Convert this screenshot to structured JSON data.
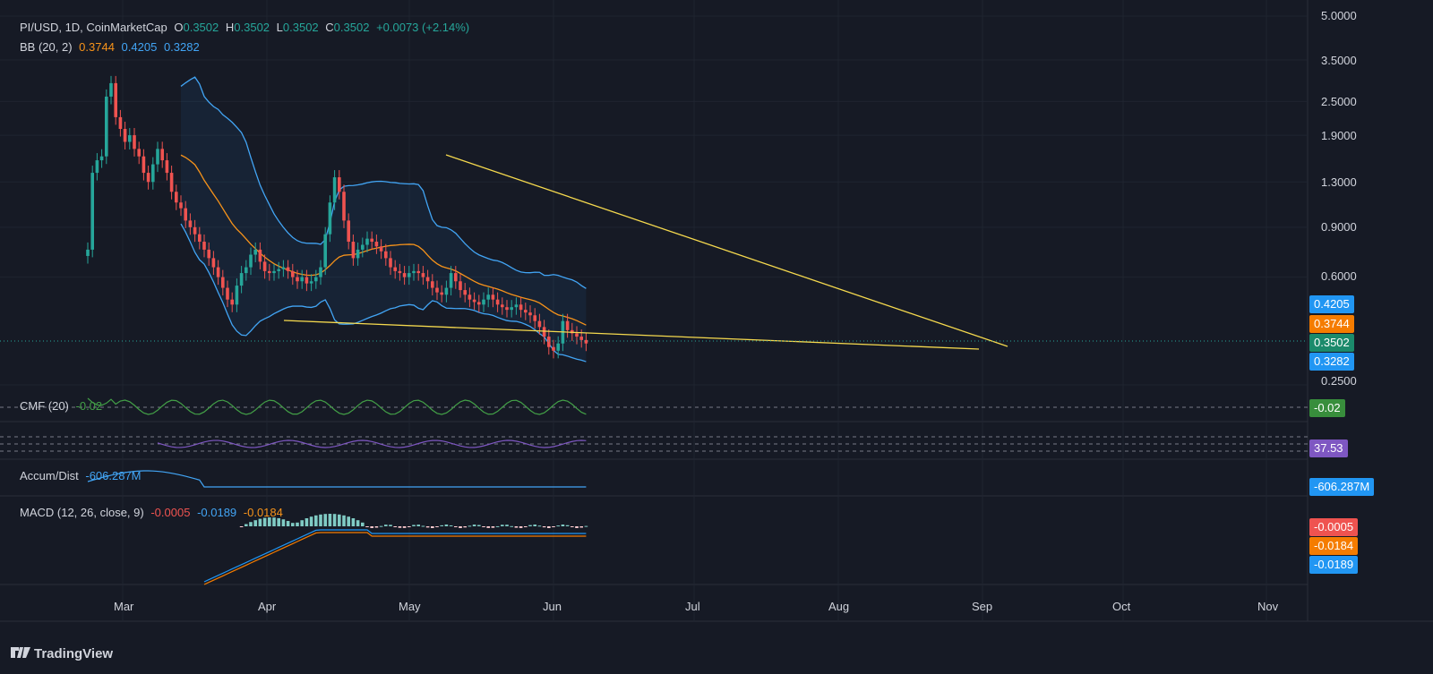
{
  "header": {
    "symbol": "PI/USD, 1D, CoinMarketCap",
    "o_key": "O",
    "o_val": "0.3502",
    "h_key": "H",
    "h_val": "0.3502",
    "l_key": "L",
    "l_val": "0.3502",
    "c_key": "C",
    "c_val": "0.3502",
    "change": "+0.0073 (+2.14%)"
  },
  "bb_legend": {
    "name": "BB (20, 2)",
    "basis": "0.3744",
    "upper": "0.4205",
    "lower": "0.3282"
  },
  "cmf_legend": {
    "name": "CMF (20)",
    "value": "-0.02"
  },
  "ad_legend": {
    "name": "Accum/Dist",
    "value": "-606.287M"
  },
  "macd_legend": {
    "name": "MACD (12, 26, close, 9)",
    "hist": "-0.0005",
    "macd": "-0.0189",
    "signal": "-0.0184"
  },
  "badges": {
    "upper": "0.4205",
    "basis": "0.3744",
    "price": "0.3502",
    "lower": "0.3282",
    "cmf": "-0.02",
    "rsi": "37.53",
    "ad": "-606.287M",
    "macd_hist": "-0.0005",
    "macd_signal": "-0.0184",
    "macd_line": "-0.0189"
  },
  "brand": "TradingView",
  "colors": {
    "background": "#161a25",
    "up": "#26a69a",
    "down": "#ef5350",
    "bb_basis": "#f7931a",
    "bb_band": "#42a5f5",
    "trendline": "#f5d94e",
    "cmf": "#43a047",
    "rsi": "#7e57c2",
    "ad": "#42a5f5"
  },
  "chart_data": [
    {
      "type": "candlestick",
      "title": "PI/USD, 1D, CoinMarketCap",
      "x_tick_labels": [
        "Mar",
        "Apr",
        "May",
        "Jun",
        "Jul",
        "Aug",
        "Sep",
        "Oct",
        "Nov"
      ],
      "y_tick_labels": [
        "5.0000",
        "3.5000",
        "2.5000",
        "1.9000",
        "1.3000",
        "0.9000",
        "0.6000",
        "0.2500"
      ],
      "y_scale": "log",
      "ylim": [
        0.2,
        5.0
      ],
      "candles_approx_close": [
        0.75,
        1.4,
        1.55,
        1.6,
        2.6,
        2.9,
        2.2,
        2.0,
        1.8,
        1.9,
        1.7,
        1.6,
        1.4,
        1.3,
        1.5,
        1.7,
        1.55,
        1.4,
        1.2,
        1.1,
        1.05,
        0.95,
        0.9,
        0.85,
        0.8,
        0.75,
        0.7,
        0.65,
        0.6,
        0.55,
        0.5,
        0.48,
        0.56,
        0.62,
        0.65,
        0.72,
        0.75,
        0.68,
        0.63,
        0.62,
        0.63,
        0.64,
        0.65,
        0.63,
        0.6,
        0.58,
        0.6,
        0.57,
        0.58,
        0.6,
        0.65,
        0.85,
        1.1,
        1.35,
        1.2,
        0.95,
        0.8,
        0.7,
        0.75,
        0.78,
        0.82,
        0.8,
        0.77,
        0.74,
        0.7,
        0.65,
        0.63,
        0.62,
        0.6,
        0.62,
        0.63,
        0.62,
        0.6,
        0.58,
        0.55,
        0.53,
        0.52,
        0.55,
        0.62,
        0.58,
        0.54,
        0.52,
        0.5,
        0.49,
        0.48,
        0.5,
        0.52,
        0.5,
        0.48,
        0.47,
        0.46,
        0.47,
        0.48,
        0.46,
        0.45,
        0.44,
        0.42,
        0.4,
        0.37,
        0.34,
        0.33,
        0.35,
        0.42,
        0.39,
        0.38,
        0.37,
        0.36,
        0.35
      ],
      "series": [
        {
          "name": "BB basis",
          "last": 0.3744
        },
        {
          "name": "BB upper",
          "last": 0.4205
        },
        {
          "name": "BB lower",
          "last": 0.3282
        }
      ],
      "annotations": [
        "descending upper trendline",
        "lower support trendline"
      ]
    },
    {
      "type": "line",
      "title": "CMF (20)",
      "series": [
        {
          "name": "CMF (20)",
          "last": -0.02
        }
      ]
    },
    {
      "type": "line",
      "title": "RSI",
      "series": [
        {
          "name": "RSI",
          "last": 37.53
        }
      ]
    },
    {
      "type": "line",
      "title": "Accum/Dist",
      "series": [
        {
          "name": "Accum/Dist",
          "last": "-606.287M"
        }
      ]
    },
    {
      "type": "bar",
      "title": "MACD (12, 26, close, 9)",
      "series": [
        {
          "name": "Histogram",
          "last": -0.0005
        },
        {
          "name": "MACD",
          "last": -0.0189
        },
        {
          "name": "Signal",
          "last": -0.0184
        }
      ]
    }
  ]
}
